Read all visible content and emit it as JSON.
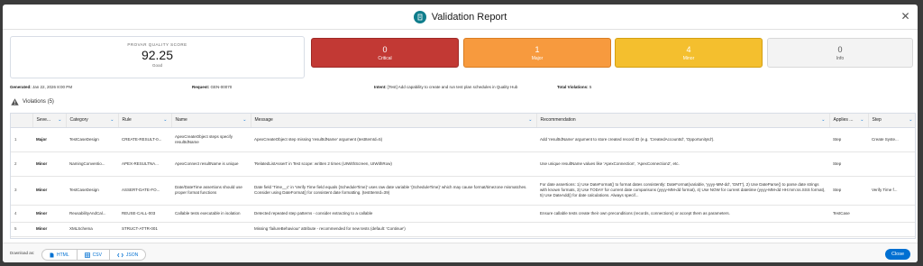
{
  "header": {
    "title": "Validation Report"
  },
  "score": {
    "label": "PROVAR QUALITY SCORE",
    "value": "92.25",
    "grade": "Good"
  },
  "severity_cards": [
    {
      "count": "0",
      "label": "Critical"
    },
    {
      "count": "1",
      "label": "Major"
    },
    {
      "count": "4",
      "label": "Minor"
    },
    {
      "count": "0",
      "label": "Info"
    }
  ],
  "meta": {
    "generated_label": "Generated:",
    "generated_value": "Jan 22, 2026 8:00 PM",
    "request_label": "Request:",
    "request_value": "GEN-00070",
    "intent_label": "Intent:",
    "intent_value": "[Test] Add capability to create and run test plan schedules in Quality Hub",
    "total_label": "Total Violations:",
    "total_value": "5"
  },
  "violations": {
    "title": "Violations (5)"
  },
  "table": {
    "columns": [
      "",
      "Seve...",
      "Category",
      "Rule",
      "Name",
      "Message",
      "Recommendation",
      "Applies ...",
      "Step"
    ],
    "rows": [
      [
        "1",
        "Major",
        "TestCaseDesign",
        "CREATE-RESULT-0...",
        "ApexCreateObject steps specify resultIdName",
        "ApexCreateObject step missing 'resultIdName' argument (testItemId=5)",
        "Add 'resultIdName' argument to store created record ID (e.g. 'CreatedAccountId', 'OpportunityId').",
        "Step",
        "Create Syste..."
      ],
      [
        "2",
        "Minor",
        "NamingConventio...",
        "APEX-RESULTNA...",
        "ApexConnect resultName is unique",
        "'RelatedListAssert' in Test scope: written 2 times (UIWithScreen, UIWithRow)",
        "Use unique resultName values like 'ApexConnection', 'ApexConnection2', etc.",
        "Step",
        ""
      ],
      [
        "3",
        "Minor",
        "TestCaseDesign",
        "ASSERT-DATE-FO...",
        "Date/DateTime assertions should use proper format functions",
        "Date field 'Time__c' in 'Verify Time field equals {ScheduleTime}' uses raw date variable '{ScheduleTime}' which may cause format/timezone mismatches. Consider using DateFormat() for consistent date formatting. (testItemId=39)",
        "For date assertions: 1) Use DateFormat() to format dates consistently: DateFormat(variable, 'yyyy-MM-dd', 'GMT'), 2) Use DateParse() to parse date strings with known formats, 3) Use TODAY for current date comparisons (yyyy-MM-dd format), 4) Use NOW for current datetime (yyyy-MM-dd HH:mm:ss.SSS format), 5) Use DateAdd() for date calculations. Always specif...",
        "Step",
        "Verify Time f..."
      ],
      [
        "4",
        "Minor",
        "ReusabilityAndCal...",
        "REUSE-CALL-003",
        "Callable tests executable in isolation",
        "Detected repeated step patterns - consider extracting to a callable",
        "Ensure callable tests create their own preconditions (records, connections) or accept them as parameters.",
        "TestCase",
        ""
      ],
      [
        "5",
        "Minor",
        "XMLSchema",
        "STRUCT-ATTR-001",
        "",
        "Missing 'failureBehaviour' attribute - recommended for new tests (default: 'Continue')",
        "",
        "",
        ""
      ]
    ]
  },
  "footer": {
    "download_label": "Download as:",
    "buttons": [
      "HTML",
      "CSV",
      "JSON"
    ],
    "close_label": "Close"
  },
  "colors": {
    "critical": "#c23934",
    "major": "#f79a3e",
    "minor": "#f4bf2e",
    "info": "#f3f3f3",
    "accent": "#0070d2"
  }
}
